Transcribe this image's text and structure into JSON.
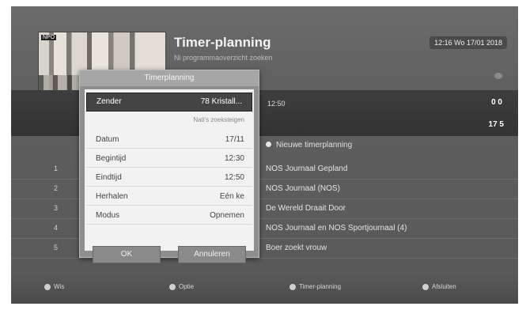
{
  "header": {
    "title": "Timer-planning",
    "subtitle": "Ni programmaoverzicht zoeken",
    "datetime": "12:16 Wo 17/01 2018",
    "thumb_badge": "NPO"
  },
  "band": {
    "time": "12:50",
    "icons": "0 0",
    "number": "17 5"
  },
  "new_timer_label": "Nieuwe timerplanning",
  "rows": [
    {
      "num": "1",
      "text": "NOS Journaal Gepland"
    },
    {
      "num": "2",
      "text": "NOS Journaal (NOS)"
    },
    {
      "num": "3",
      "text": "De Wereld Draait Door"
    },
    {
      "num": "4",
      "text": "NOS Journaal en NOS Sportjournaal (4)"
    },
    {
      "num": "5",
      "text": "Boer zoekt vrouw"
    }
  ],
  "bottom_hints": [
    "Wis",
    "Optie",
    "Timer-planning",
    "Afsluiten"
  ],
  "dialog": {
    "title": "Timerplanning",
    "zender_label": "Zender",
    "zender_value": "78 Kristall...",
    "program_name": "Nati's zoeksteigen",
    "fields": [
      {
        "label": "Datum",
        "value": "17/11"
      },
      {
        "label": "Begintijd",
        "value": "12:30"
      },
      {
        "label": "Eindtijd",
        "value": "12:50"
      },
      {
        "label": "Herhalen",
        "value": "Eén ke"
      },
      {
        "label": "Modus",
        "value": "Opnemen"
      }
    ],
    "ok_label": "OK",
    "cancel_label": "Annuleren"
  }
}
